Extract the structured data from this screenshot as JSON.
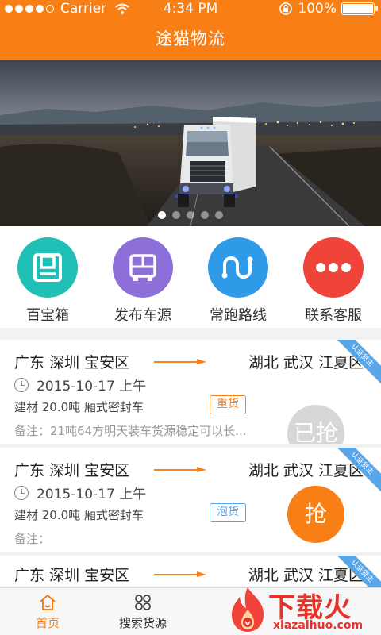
{
  "status_bar": {
    "carrier": "Carrier",
    "time": "4:34 PM",
    "battery": "100%"
  },
  "header": {
    "title": "途猫物流"
  },
  "banner": {
    "slide_count": 5,
    "active_slide": 0
  },
  "menu": [
    {
      "label": "百宝箱",
      "icon": "toolbox-icon",
      "color": "#1fbfb5"
    },
    {
      "label": "发布车源",
      "icon": "bus-icon",
      "color": "#8c6fd9"
    },
    {
      "label": "常跑路线",
      "icon": "route-icon",
      "color": "#2e9ae8"
    },
    {
      "label": "联系客服",
      "icon": "more-dots-icon",
      "color": "#f0443a"
    }
  ],
  "orders": [
    {
      "from": "广东 深圳 宝安区",
      "to": "湖北 武汉 江夏区",
      "date": "2015-10-17  上午",
      "detail": "建材  20.0吨  厢式密封车",
      "tag": "重货",
      "tag_type": "heavy",
      "remark": "备注：21吨64方明天装车货源稳定可以长...",
      "action": "已抢",
      "action_state": "done",
      "badge": "认证货主"
    },
    {
      "from": "广东 深圳 宝安区",
      "to": "湖北 武汉 江夏区",
      "date": "2015-10-17  上午",
      "detail": "建材  20.0吨  厢式密封车",
      "tag": "泡货",
      "tag_type": "light",
      "remark": "备注：",
      "action": "抢",
      "action_state": "active",
      "badge": "认证货主"
    },
    {
      "from": "广东 深圳 宝安区",
      "to": "湖北 武汉 江夏区",
      "badge": "认证货主"
    }
  ],
  "bottom_nav": [
    {
      "label": "首页",
      "icon": "home-icon",
      "active": true
    },
    {
      "label": "搜索货源",
      "icon": "grid-icon",
      "active": false
    }
  ],
  "watermark": {
    "text": "下载火",
    "sub": "xiazaihuo.com"
  },
  "colors": {
    "primary": "#f77f16",
    "accent_blue": "#5aa5e8",
    "grabbed_gray": "#d7d7d7"
  }
}
